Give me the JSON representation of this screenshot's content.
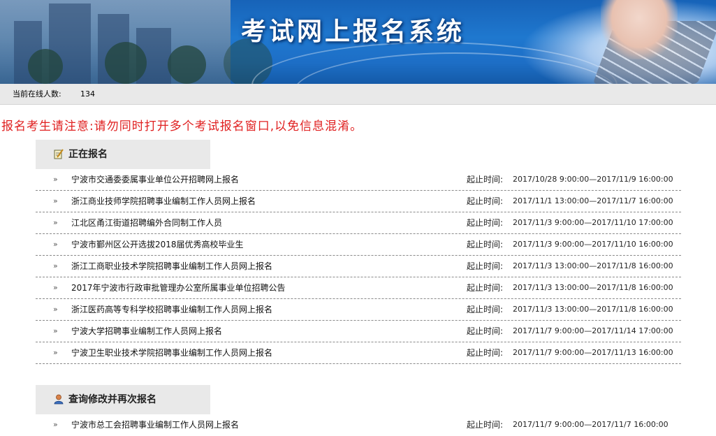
{
  "header": {
    "title": "考试网上报名系统"
  },
  "online": {
    "label": "当前在线人数:",
    "count": "134"
  },
  "notice": "报名考生请注意:请勿同时打开多个考试报名窗口,以免信息混淆。",
  "sections": [
    {
      "heading": "正在报名",
      "icon": "edit-note-icon",
      "items": [
        {
          "name": "宁波市交通委委属事业单位公开招聘网上报名",
          "time_label": "起止时间:",
          "time": "2017/10/28 9:00:00—2017/11/9 16:00:00"
        },
        {
          "name": "浙江商业技师学院招聘事业编制工作人员网上报名",
          "time_label": "起止时间:",
          "time": "2017/11/1 13:00:00—2017/11/7 16:00:00"
        },
        {
          "name": "江北区甬江街道招聘编外合同制工作人员",
          "time_label": "起止时间:",
          "time": "2017/11/3 9:00:00—2017/11/10 17:00:00"
        },
        {
          "name": "宁波市鄞州区公开选拔2018届优秀高校毕业生",
          "time_label": "起止时间:",
          "time": "2017/11/3 9:00:00—2017/11/10 16:00:00"
        },
        {
          "name": "浙江工商职业技术学院招聘事业编制工作人员网上报名",
          "time_label": "起止时间:",
          "time": "2017/11/3 13:00:00—2017/11/8 16:00:00"
        },
        {
          "name": "2017年宁波市行政审批管理办公室所属事业单位招聘公告",
          "time_label": "起止时间:",
          "time": "2017/11/3 13:00:00—2017/11/8 16:00:00"
        },
        {
          "name": "浙江医药高等专科学校招聘事业编制工作人员网上报名",
          "time_label": "起止时间:",
          "time": "2017/11/3 13:00:00—2017/11/8 16:00:00"
        },
        {
          "name": "宁波大学招聘事业编制工作人员网上报名",
          "time_label": "起止时间:",
          "time": "2017/11/7 9:00:00—2017/11/14 17:00:00"
        },
        {
          "name": "宁波卫生职业技术学院招聘事业编制工作人员网上报名",
          "time_label": "起止时间:",
          "time": "2017/11/7 9:00:00—2017/11/13 16:00:00"
        }
      ]
    },
    {
      "heading": "查询修改并再次报名",
      "icon": "user-icon",
      "items": [
        {
          "name": "宁波市总工会招聘事业编制工作人员网上报名",
          "time_label": "起止时间:",
          "time": "2017/11/7 9:00:00—2017/11/7 16:00:00"
        }
      ]
    }
  ]
}
